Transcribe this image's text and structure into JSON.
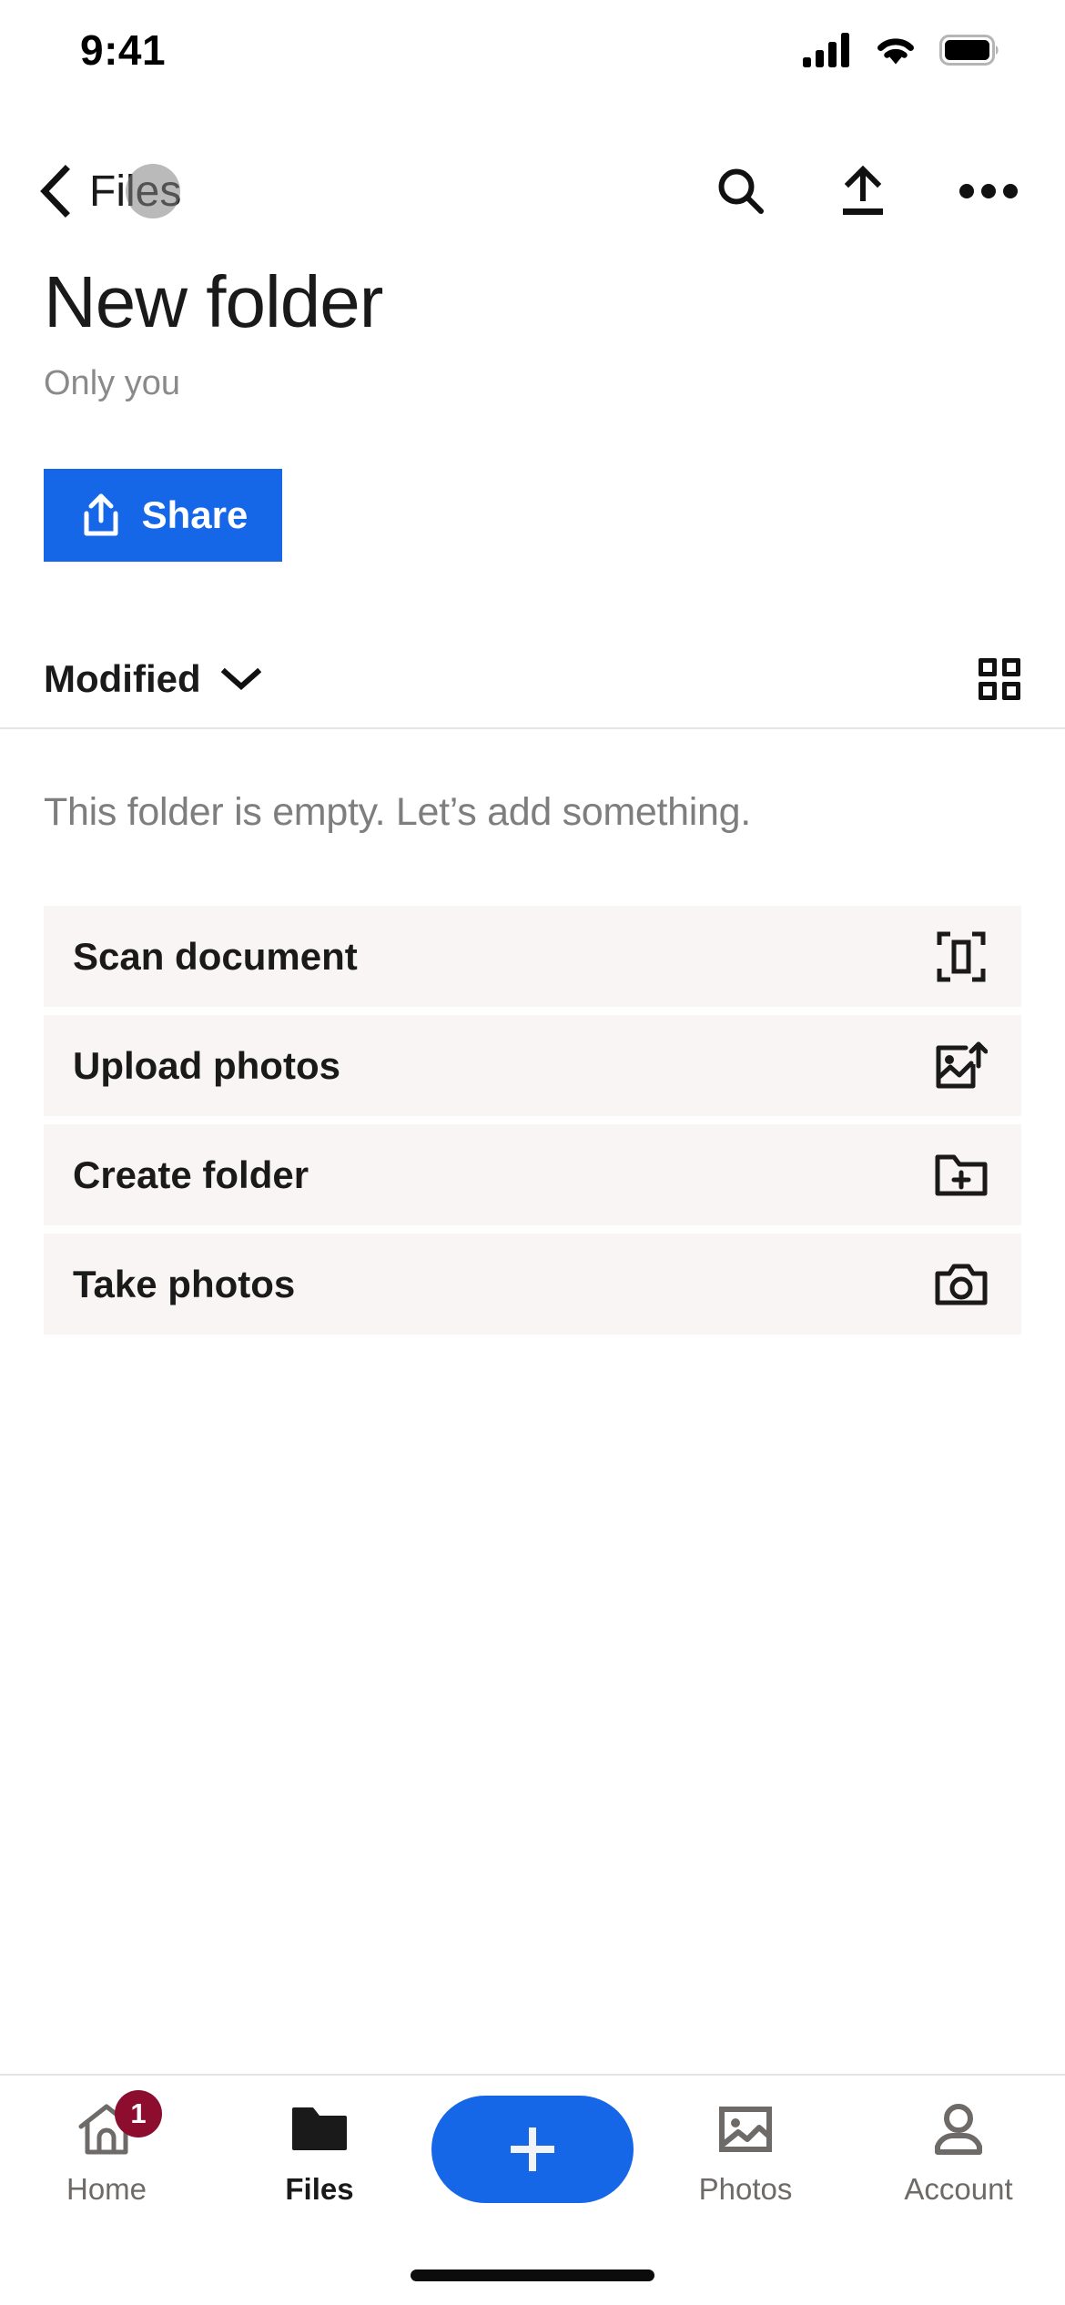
{
  "status_bar": {
    "time": "9:41",
    "cellular_icon": "cellular-signal-icon",
    "wifi_icon": "wifi-icon",
    "battery_icon": "battery-full-icon"
  },
  "nav_bar": {
    "back_label": "Files",
    "back_icon": "chevron-left-icon",
    "actions": [
      {
        "name": "search-icon",
        "label": "Search"
      },
      {
        "name": "upload-icon",
        "label": "Upload"
      },
      {
        "name": "more-options-icon",
        "label": "More options"
      }
    ]
  },
  "header": {
    "title": "New folder",
    "subtitle": "Only you",
    "share_label": "Share",
    "share_icon": "share-icon",
    "share_color": "#1667e8"
  },
  "sort_row": {
    "sort_label": "Modified",
    "sort_chevron": "chevron-down-icon",
    "view_toggle_icon": "grid-view-icon"
  },
  "empty_state": {
    "message": "This folder is empty. Let’s add something."
  },
  "actions": [
    {
      "label": "Scan document",
      "icon": "scan-document-icon"
    },
    {
      "label": "Upload photos",
      "icon": "upload-photo-icon"
    },
    {
      "label": "Create folder",
      "icon": "create-folder-icon"
    },
    {
      "label": "Take photos",
      "icon": "camera-icon"
    }
  ],
  "tab_bar": {
    "accent_color": "#1667e8",
    "badge_color": "#8c0d2e",
    "tabs": [
      {
        "label": "Home",
        "icon": "home-icon",
        "active": false,
        "badge": "1"
      },
      {
        "label": "Files",
        "icon": "folder-icon",
        "active": true,
        "badge": ""
      },
      {
        "label": "Photos",
        "icon": "photos-icon",
        "active": false,
        "badge": ""
      },
      {
        "label": "Account",
        "icon": "account-icon",
        "active": false,
        "badge": ""
      }
    ],
    "fab": {
      "label": "Add",
      "icon": "plus-icon"
    }
  }
}
